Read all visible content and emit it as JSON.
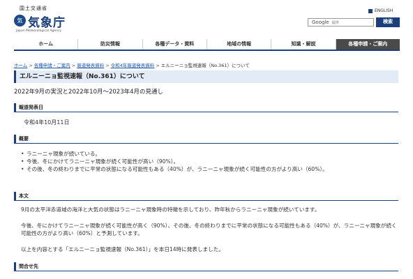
{
  "header": {
    "ministry": "国土交通省",
    "emblem": "気",
    "agency": "気象庁",
    "agency_en": "Japan Meteorological Agency",
    "english": "ENGLISH",
    "search_brand": "Google",
    "search_placeholder": "提供",
    "search_button": "検索"
  },
  "nav": [
    "ホーム",
    "防災情報",
    "各種データ・資料",
    "地域の情報",
    "知識・解説",
    "各種申請・ご案内"
  ],
  "breadcrumb": {
    "links": [
      "ホーム",
      "各種申請・ご案内",
      "報道発表資料",
      "令和4年報道発表資料"
    ],
    "current": "エルニーニョ監視速報（No.361）について"
  },
  "title": "エルニーニョ監視速報（No.361）について",
  "subtitle": "2022年9月の実況と2022年10月～2023年4月の見通し",
  "sections": {
    "date_head": "報道発表日",
    "date": "令和4年10月11日",
    "summary_head": "概要",
    "summary": [
      "ラニーニャ現象が続いている。",
      "今後、冬にかけてラニーニャ現象が続く可能性が高い（90%）。",
      "その後、冬の終わりまでに平常の状態になる可能性もある（40%）が、ラニーニャ現象が続く可能性の方がより高い（60%）。"
    ],
    "body_head": "本文",
    "body1": "9月の太平洋赤道域の海洋と大気の状態はラニーニャ現象時の特徴を示しており、昨年秋からラニーニャ現象が続いています。",
    "body2": "今後、冬にかけてラニーニャ現象が続く可能性が高く（90%）、その後、冬の終わりまでに平常の状態になる可能性もある（40%）が、ラニーニャ現象が続く可能性の方がより高い（60%）と予測しています。",
    "body3": "以上を内容とする「エルニーニョ監視速報（No.361）」を本日14時に発表しました。",
    "contact_head": "問合せ先"
  }
}
